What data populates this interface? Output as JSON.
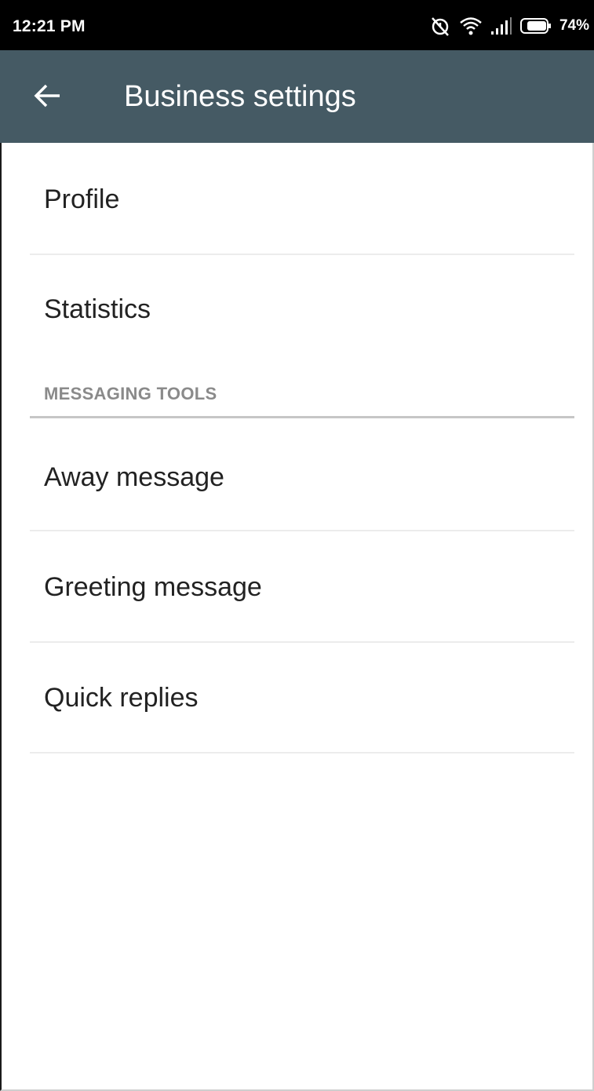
{
  "status_bar": {
    "time": "12:21 PM",
    "battery_percent": "74%",
    "icons": [
      "alarm-off-icon",
      "wifi-icon",
      "signal-icon",
      "battery-icon"
    ]
  },
  "app_bar": {
    "title": "Business settings",
    "back_icon": "arrow-back-icon",
    "background_color": "#455a64"
  },
  "settings": {
    "items": [
      {
        "label": "Profile"
      },
      {
        "label": "Statistics"
      }
    ],
    "messaging_section": {
      "header": "MESSAGING TOOLS",
      "items": [
        {
          "label": "Away message"
        },
        {
          "label": "Greeting message"
        },
        {
          "label": "Quick replies"
        }
      ]
    }
  }
}
